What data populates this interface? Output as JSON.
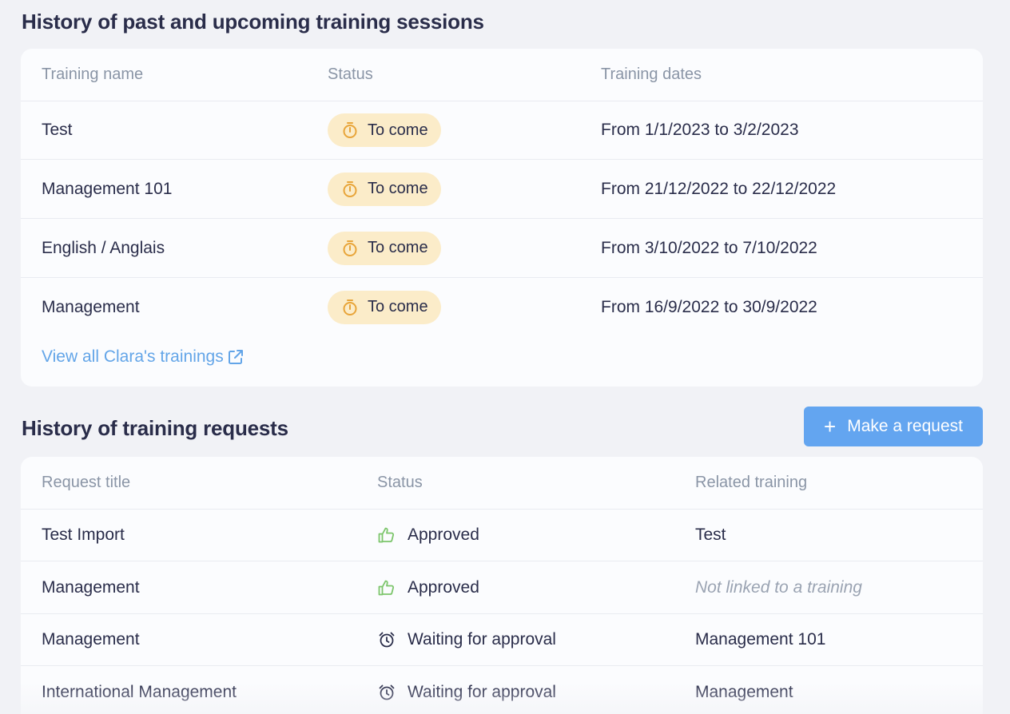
{
  "sessions": {
    "title": "History of past and upcoming training sessions",
    "headers": {
      "name": "Training name",
      "status": "Status",
      "dates": "Training dates"
    },
    "rows": [
      {
        "name": "Test",
        "status": "To come",
        "dates": "From 1/1/2023 to 3/2/2023"
      },
      {
        "name": "Management 101",
        "status": "To come",
        "dates": "From 21/12/2022 to 22/12/2022"
      },
      {
        "name": "English / Anglais",
        "status": "To come",
        "dates": "From 3/10/2022 to 7/10/2022"
      },
      {
        "name": "Management",
        "status": "To come",
        "dates": "From 16/9/2022 to 30/9/2022"
      }
    ],
    "view_all": "View all Clara's trainings"
  },
  "requests": {
    "title": "History of training requests",
    "button": {
      "icon": "plus-icon",
      "label": "Make a request"
    },
    "headers": {
      "title": "Request title",
      "status": "Status",
      "related": "Related training"
    },
    "rows": [
      {
        "title": "Test Import",
        "status_icon": "thumbs-up-icon",
        "status": "Approved",
        "related": "Test"
      },
      {
        "title": "Management",
        "status_icon": "thumbs-up-icon",
        "status": "Approved",
        "related": "Not linked to a training"
      },
      {
        "title": "Management",
        "status_icon": "alarm-clock-icon",
        "status": "Waiting for approval",
        "related": "Management 101"
      },
      {
        "title": "International Management",
        "status_icon": "alarm-clock-icon",
        "status": "Waiting for approval",
        "related": "Management"
      }
    ]
  },
  "colors": {
    "accent": "#63a5f0",
    "pill_bg": "#fbecc9",
    "pill_icon": "#e8a53a",
    "approved": "#7cc56b"
  }
}
